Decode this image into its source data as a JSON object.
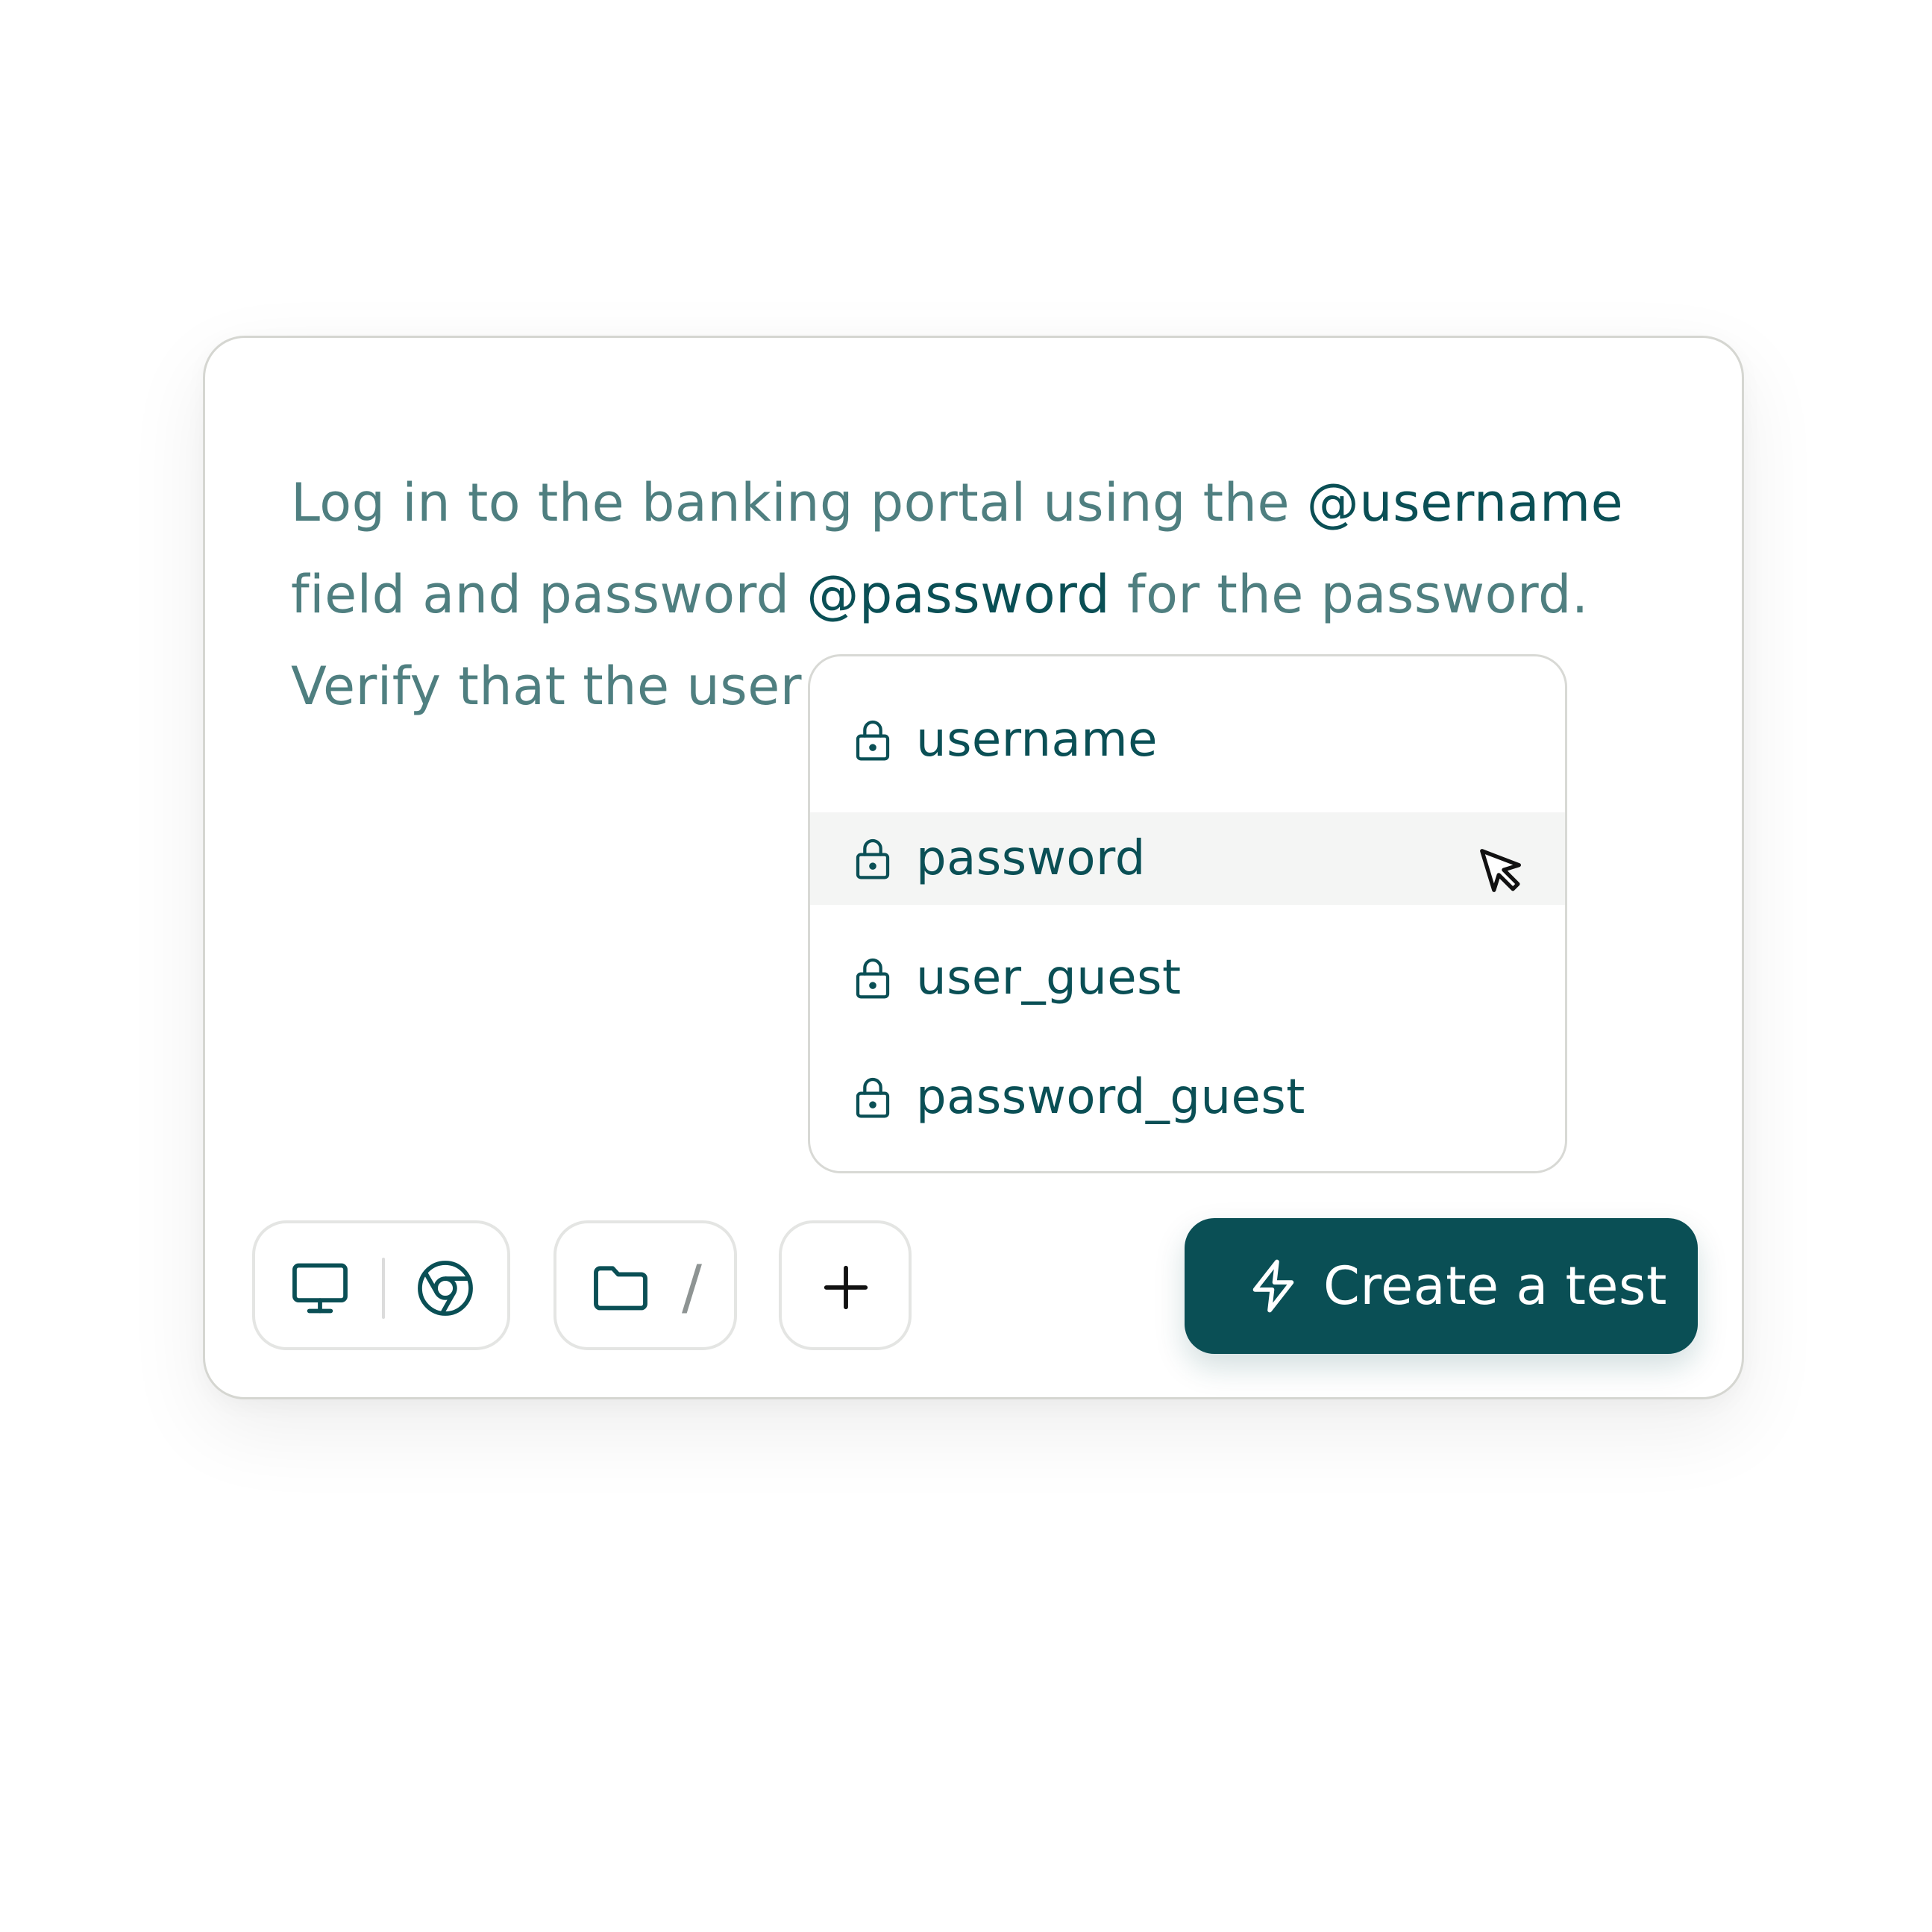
{
  "prompt": {
    "line1_text": "Log in to the banking portal using the ",
    "line1_mention": "@username",
    "line2_text_a": "field and password ",
    "line2_mention": "@password",
    "line2_text_b": " for the password.",
    "line3_text": "Verify that the user"
  },
  "dropdown": {
    "items": [
      {
        "label": "username",
        "icon": "lock-icon",
        "hovered": false
      },
      {
        "label": "password",
        "icon": "lock-icon",
        "hovered": true
      },
      {
        "label": "user_guest",
        "icon": "lock-icon",
        "hovered": false
      },
      {
        "label": "password_guest",
        "icon": "lock-icon",
        "hovered": false
      }
    ]
  },
  "toolbar": {
    "environment": {
      "device_icon": "monitor-icon",
      "browser_icon": "chrome-icon"
    },
    "folder": {
      "icon": "folder-icon",
      "path": "/"
    },
    "add": {
      "icon": "plus-icon"
    }
  },
  "create_button": {
    "label": "Create a test",
    "icon": "lightning-bolt-icon"
  },
  "colors": {
    "accent": "#0a4f55",
    "text_muted": "#4f7f80",
    "hover_bg": "#f4f5f4",
    "border": "#d5d6d1"
  }
}
